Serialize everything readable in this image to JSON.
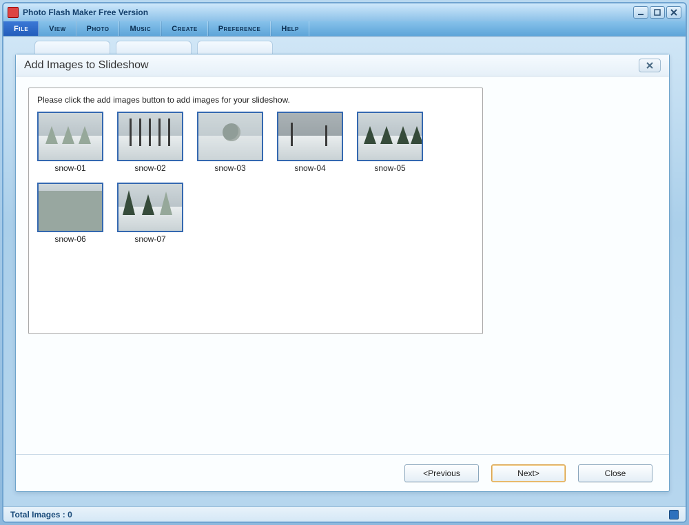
{
  "app": {
    "title": "Photo Flash Maker Free Version"
  },
  "menubar": {
    "items": [
      {
        "label": "File",
        "active": true
      },
      {
        "label": "View",
        "active": false
      },
      {
        "label": "Photo",
        "active": false
      },
      {
        "label": "Music",
        "active": false
      },
      {
        "label": "Create",
        "active": false
      },
      {
        "label": "Preference",
        "active": false
      },
      {
        "label": "Help",
        "active": false
      }
    ]
  },
  "dialog": {
    "title": "Add Images to Slideshow",
    "instruction": "Please click the add images button to add  images for your slideshow.",
    "thumbs": [
      {
        "label": "snow-01"
      },
      {
        "label": "snow-02"
      },
      {
        "label": "snow-03"
      },
      {
        "label": "snow-04"
      },
      {
        "label": "snow-05"
      },
      {
        "label": "snow-06"
      },
      {
        "label": "snow-07"
      }
    ],
    "buttons": {
      "previous": "<Previous",
      "next": "Next>",
      "close": "Close"
    }
  },
  "status": {
    "total_images_label": "Total Images : 0"
  }
}
